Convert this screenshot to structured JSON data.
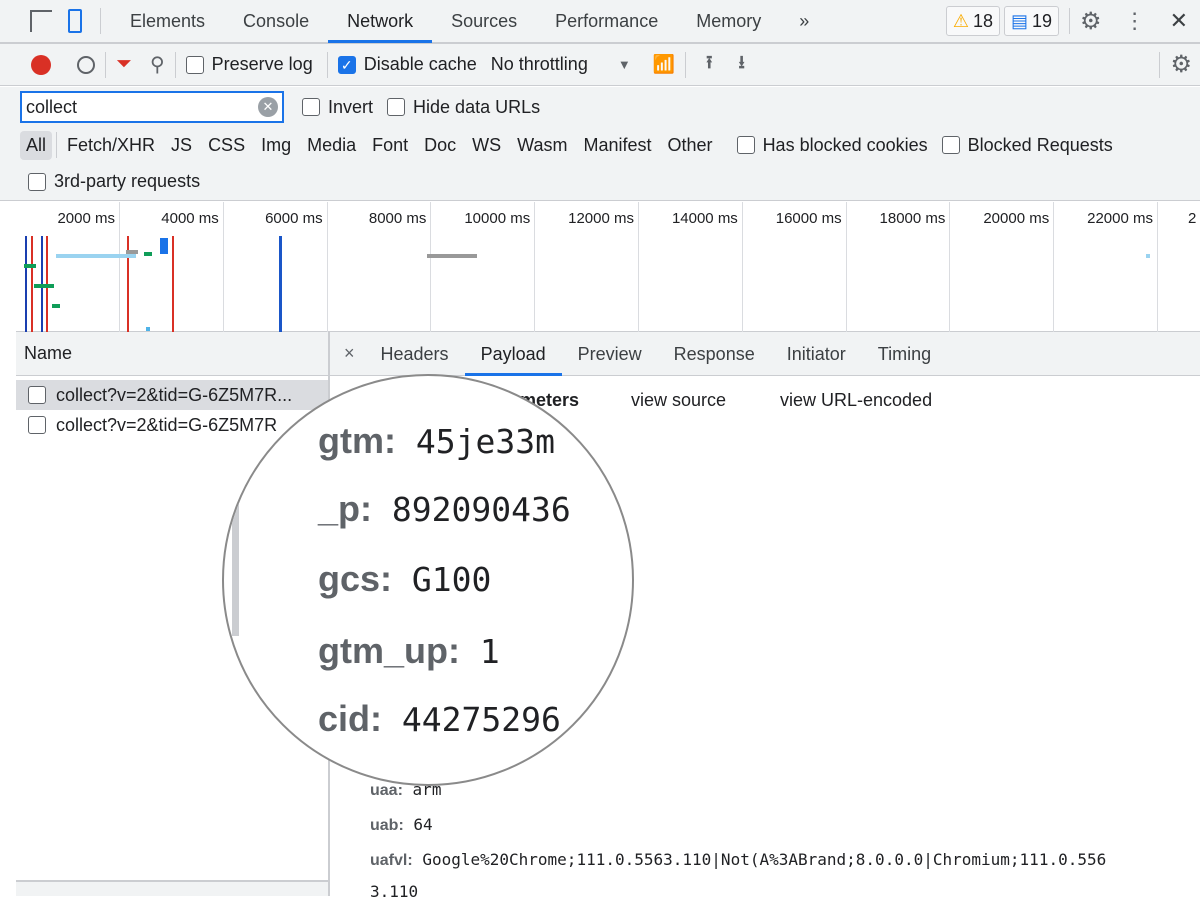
{
  "tabs": {
    "items": [
      "Elements",
      "Console",
      "Network",
      "Sources",
      "Performance",
      "Memory"
    ],
    "active": "Network",
    "more": "»",
    "warnings": "18",
    "messages": "19"
  },
  "toolbar": {
    "preserve_log": "Preserve log",
    "preserve_log_checked": false,
    "disable_cache": "Disable cache",
    "disable_cache_checked": true,
    "throttling": "No throttling"
  },
  "filter": {
    "value": "collect",
    "invert": "Invert",
    "hide_data_urls": "Hide data URLs"
  },
  "types": {
    "items": [
      "All",
      "Fetch/XHR",
      "JS",
      "CSS",
      "Img",
      "Media",
      "Font",
      "Doc",
      "WS",
      "Wasm",
      "Manifest",
      "Other"
    ],
    "active": "All",
    "has_blocked_cookies": "Has blocked cookies",
    "blocked_requests": "Blocked Requests",
    "third_party": "3rd-party requests"
  },
  "timeline": {
    "ticks": [
      "2000 ms",
      "4000 ms",
      "6000 ms",
      "8000 ms",
      "10000 ms",
      "12000 ms",
      "14000 ms",
      "16000 ms",
      "18000 ms",
      "20000 ms",
      "22000 ms",
      "2"
    ]
  },
  "requests": {
    "header": "Name",
    "items": [
      "collect?v=2&tid=G-6Z5M7R...",
      "collect?v=2&tid=G-6Z5M7R"
    ]
  },
  "detail": {
    "close": "×",
    "tabs": [
      "Headers",
      "Payload",
      "Preview",
      "Response",
      "Initiator",
      "Timing"
    ],
    "active": "Payload",
    "section_title": "meters",
    "view_source": "view source",
    "view_url_encoded": "view URL-encoded",
    "params": [
      {
        "k": "uaa:",
        "v": "arm"
      },
      {
        "k": "uab:",
        "v": "64"
      },
      {
        "k": "uafvl:",
        "v": "Google%20Chrome;111.0.5563.110|Not(A%3ABrand;8.0.0.0|Chromium;111.0.556"
      },
      {
        "k": "",
        "v": "3.110"
      }
    ]
  },
  "magnifier": {
    "rows": [
      {
        "k": "gtm:",
        "v": "45je33m"
      },
      {
        "k": "_p:",
        "v": "892090436"
      },
      {
        "k": "gcs:",
        "v": "G100"
      },
      {
        "k": "gtm_up:",
        "v": "1"
      },
      {
        "k": "cid:",
        "v": "44275296"
      }
    ]
  },
  "colors": {
    "accent": "#1a73e8",
    "record": "#d93025",
    "warning": "#f9ab00"
  }
}
